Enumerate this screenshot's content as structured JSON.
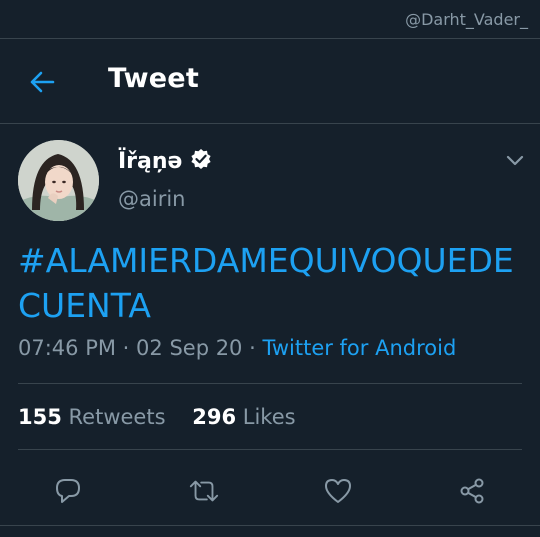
{
  "watermark": "@Darht_Vader_",
  "header": {
    "title": "Tweet",
    "back_icon": "back-arrow-icon"
  },
  "tweet": {
    "display_name": "Ïřąņə",
    "verified_icon": "verified-badge-icon",
    "handle": "@airin",
    "text": "#ALAMIERDAMEQUIVOQUEDECUENTA",
    "time": "07:46 PM",
    "date": "02 Sep 20",
    "source": "Twitter for Android",
    "separator": "·"
  },
  "stats": {
    "retweets_count": "155",
    "retweets_label": "Retweets",
    "likes_count": "296",
    "likes_label": "Likes"
  },
  "actions": [
    "reply-icon",
    "retweet-icon",
    "like-icon",
    "share-icon"
  ],
  "colors": {
    "background": "#15202b",
    "accent": "#1da1f2",
    "secondary_text": "#8899a6",
    "divider": "#38444d"
  }
}
